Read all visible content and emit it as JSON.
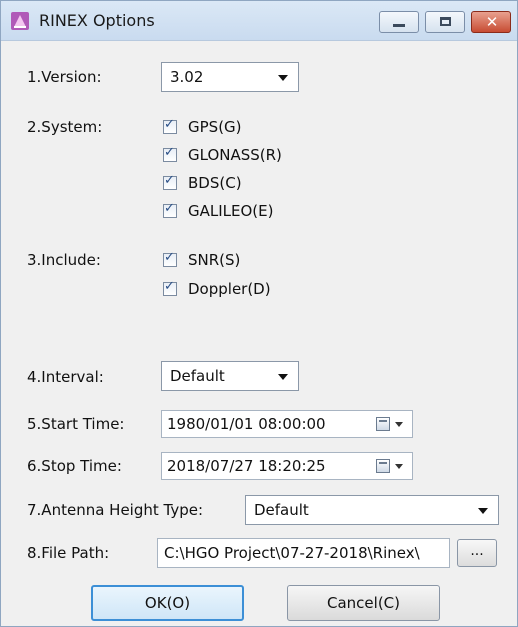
{
  "window": {
    "title": "RINEX Options",
    "controls": {
      "minimize": "minimize-icon",
      "maximize": "maximize-icon",
      "close": "close-icon"
    }
  },
  "version": {
    "label": "1.Version:",
    "value": "3.02"
  },
  "system": {
    "label": "2.System:",
    "options": [
      {
        "label": "GPS(G)",
        "checked": true
      },
      {
        "label": "GLONASS(R)",
        "checked": true
      },
      {
        "label": "BDS(C)",
        "checked": true
      },
      {
        "label": "GALILEO(E)",
        "checked": true
      }
    ]
  },
  "include": {
    "label": "3.Include:",
    "options": [
      {
        "label": "SNR(S)",
        "checked": true
      },
      {
        "label": "Doppler(D)",
        "checked": true
      }
    ]
  },
  "interval": {
    "label": "4.Interval:",
    "value": "Default"
  },
  "start_time": {
    "label": "5.Start Time:",
    "value": "1980/01/01 08:00:00"
  },
  "stop_time": {
    "label": "6.Stop Time:",
    "value": "2018/07/27 18:20:25"
  },
  "antenna": {
    "label": "7.Antenna Height Type:",
    "value": "Default"
  },
  "file_path": {
    "label": "8.File Path:",
    "value": "C:\\HGO Project\\07-27-2018\\Rinex\\",
    "browse_label": "..."
  },
  "buttons": {
    "ok": "OK(O)",
    "cancel": "Cancel(C)"
  },
  "colors": {
    "titlebar": "#c9dbef",
    "ok_border": "#3c8fd6",
    "close_button": "#c74c33",
    "check_tick": "#2a4f86"
  }
}
